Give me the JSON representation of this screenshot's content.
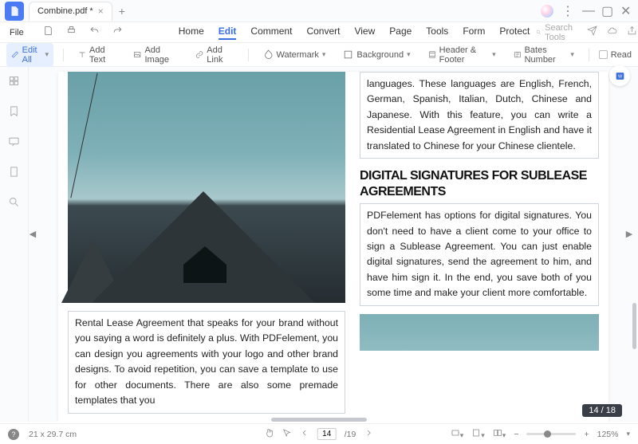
{
  "title": {
    "tab_name": "Combine.pdf *"
  },
  "file_menu": "File",
  "menu": {
    "home": "Home",
    "edit": "Edit",
    "comment": "Comment",
    "convert": "Convert",
    "view": "View",
    "page": "Page",
    "tools": "Tools",
    "form": "Form",
    "protect": "Protect",
    "search_placeholder": "Search Tools"
  },
  "toolbar": {
    "edit_all": "Edit All",
    "add_text": "Add Text",
    "add_image": "Add Image",
    "add_link": "Add Link",
    "watermark": "Watermark",
    "background": "Background",
    "header_footer": "Header & Footer",
    "bates_number": "Bates Number",
    "read": "Read"
  },
  "doc": {
    "col1_text": "Rental Lease Agreement that speaks for your brand without you saying a word is definitely a plus. With PDFelement, you can design you agreements with your logo and other brand designs. To avoid repetition, you can save a template to use for other documents. There are also some premade templates that you",
    "col2_top": "languages. These languages are English, French, German, Spanish, Italian, Dutch, Chinese and Japanese. With this feature, you can write a Residential Lease Agreement in English and have it translated to Chinese for your Chinese clientele.",
    "col2_h": "DIGITAL SIGNATURES FOR SUBLEASE AGREEMENTS",
    "col2_bot": "PDFelement has options for digital signatures. You don't need to have a client come to your office to sign a Sublease Agreement. You can just enable digital signatures, send the agreement to him, and have him sign it. In the end, you save both of you some time and make your client more comfortable."
  },
  "status": {
    "page_size": "21 x 29.7 cm",
    "cur_page": "14",
    "total_pages": "/19",
    "page_badge": "14 / 18",
    "zoom": "125%"
  }
}
